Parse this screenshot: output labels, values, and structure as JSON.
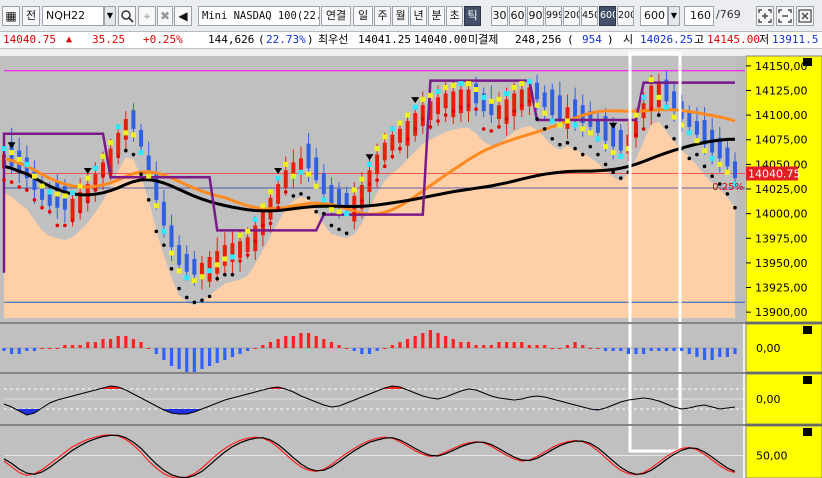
{
  "toolbar": {
    "dropdown_icon": "▼",
    "grid_icon_label": "▦",
    "mode_label": "전",
    "symbol": "NQH22",
    "search_icon": "search-icon",
    "close_label": "✖",
    "cursor_icon_label": "⌖",
    "volume_icon_label": "◀",
    "instrument_name": "Mini NASDAQ 100(22.03)",
    "linked_label": "연결",
    "period_labels": [
      "일",
      "주",
      "월",
      "년",
      "분",
      "초",
      "틱"
    ],
    "selected_period": "틱",
    "tick_presets": [
      "30",
      "60",
      "90",
      "999",
      "200",
      "450",
      "600",
      "200"
    ],
    "selected_tick": "600",
    "tick_value": "600",
    "view_count": "160",
    "total_count": "/769",
    "colors": {
      "selected_bg": "#44506a"
    }
  },
  "quote": {
    "price": "14040.75",
    "direction_icon": "▲",
    "change": "35.25",
    "change_pct": "+0.25%",
    "volume": "144,626",
    "volume_ratio": "22.73%",
    "best_ask_label": "최우선",
    "best_ask": "14041.25",
    "best_bid": "14040.00",
    "open_interest_label": "미결제",
    "open_interest": "248,256",
    "oi_change": "954",
    "open_label": "시",
    "open": "14026.25",
    "high_label": "고",
    "high": "14145.00",
    "low_label": "저",
    "low": "13911.5"
  },
  "chart_data": [
    {
      "type": "line",
      "panel": "price",
      "description": "Candlestick price chart with moving averages, parabolic SAR and channel",
      "y_ticks": [
        "14150,00",
        "14125,00",
        "14100,00",
        "14075,00",
        "14050,00",
        "14025,00",
        "14000,00",
        "13975,00",
        "13950,00",
        "13925,00",
        "13900,00"
      ],
      "ylim": [
        13890,
        14160
      ],
      "last_price_label": "14040.75",
      "last_change_label": "0.25%",
      "colors": {
        "up": "#e8200a",
        "down": "#3060e0",
        "cyan": "#30e8ff",
        "yellow": "#f0f020",
        "ma_orange": "#ff8a20",
        "ma_black": "#000000",
        "channel": "#7a1a8a",
        "fill": "#ffcfa8",
        "background": "#c0c0c0",
        "label_bg": "#ffff00"
      },
      "series": [
        {
          "values": [
            14056,
            14052,
            14045,
            14040,
            14028,
            14018,
            14012,
            14010,
            14008,
            14011,
            14018,
            14026,
            14036,
            14048,
            14062,
            14078,
            14092,
            14090,
            14072,
            14048,
            14018,
            13992,
            13970,
            13952,
            13945,
            13942,
            13946,
            13952,
            13958,
            13964,
            13966,
            13968,
            13972,
            13984,
            13998,
            14012,
            14026,
            14040,
            14048,
            14052,
            14050,
            14038,
            14024,
            14014,
            14012,
            14010,
            14014,
            14025,
            14040,
            14056,
            14068,
            14076,
            14082,
            14090,
            14098,
            14106,
            14110,
            14114,
            14118,
            14120,
            14122,
            14122,
            14116,
            14108,
            14104,
            14106,
            14112,
            14118,
            14122,
            14124,
            14120,
            14112,
            14104,
            14100,
            14104,
            14100,
            14096,
            14092,
            14086,
            14078,
            14072,
            14068,
            14076,
            14090,
            14108,
            14126,
            14128,
            14118,
            14108,
            14100,
            14092,
            14084,
            14074,
            14066,
            14060,
            14052,
            14040
          ]
        }
      ]
    },
    {
      "type": "bar",
      "panel": "histogram",
      "y_ticks": [
        "0,00"
      ],
      "values": [
        -1,
        -2,
        -2,
        -1,
        -1,
        0,
        0,
        0,
        1,
        1,
        1,
        2,
        2,
        3,
        3,
        4,
        4,
        3,
        2,
        0,
        -2,
        -4,
        -6,
        -7,
        -8,
        -8,
        -7,
        -6,
        -5,
        -4,
        -3,
        -2,
        -1,
        0,
        1,
        2,
        3,
        4,
        4,
        5,
        5,
        4,
        3,
        2,
        1,
        0,
        -1,
        -2,
        -2,
        -1,
        0,
        1,
        2,
        3,
        4,
        5,
        6,
        5,
        4,
        3,
        2,
        2,
        1,
        1,
        1,
        2,
        2,
        2,
        2,
        1,
        1,
        1,
        0,
        0,
        1,
        2,
        1,
        0,
        0,
        -1,
        -1,
        -1,
        -2,
        -2,
        -2,
        -1,
        -1,
        -1,
        -1,
        -1,
        -2,
        -3,
        -4,
        -4,
        -3,
        -3,
        -2
      ]
    },
    {
      "type": "area",
      "panel": "oscillator",
      "y_ticks": [
        "0,00"
      ],
      "values": [
        -5,
        -8,
        -12,
        -16,
        -14,
        -9,
        -4,
        -1,
        1,
        3,
        5,
        7,
        9,
        11,
        13,
        12,
        9,
        5,
        1,
        -3,
        -7,
        -11,
        -14,
        -15,
        -15,
        -13,
        -10,
        -7,
        -4,
        -1,
        1,
        3,
        5,
        7,
        9,
        11,
        12,
        10,
        7,
        3,
        0,
        -3,
        -6,
        -8,
        -7,
        -4,
        -1,
        2,
        5,
        8,
        11,
        13,
        12,
        9,
        6,
        3,
        1,
        0,
        2,
        5,
        8,
        10,
        9,
        6,
        3,
        1,
        0,
        -1,
        0,
        2,
        3,
        2,
        0,
        -2,
        -4,
        -6,
        -8,
        -10,
        -11,
        -9,
        -6,
        -3,
        -1,
        0,
        1,
        0,
        -2,
        -5,
        -8,
        -10,
        -9,
        -7,
        -6,
        -8,
        -10,
        -9,
        -8
      ]
    },
    {
      "type": "line",
      "panel": "stochastic",
      "y_ticks": [
        "50,00"
      ],
      "series": [
        {
          "values": [
            40,
            30,
            20,
            15,
            18,
            25,
            35,
            45,
            55,
            65,
            72,
            78,
            82,
            85,
            86,
            84,
            78,
            68,
            55,
            40,
            28,
            18,
            12,
            10,
            12,
            18,
            28,
            40,
            52,
            62,
            70,
            76,
            80,
            82,
            80,
            74,
            64,
            52,
            40,
            30,
            24,
            22,
            26,
            34,
            44,
            54,
            62,
            70,
            76,
            80,
            82,
            80,
            74,
            66,
            58,
            52,
            48,
            50,
            56,
            62,
            68,
            72,
            74,
            72,
            66,
            58,
            50,
            44,
            40,
            42,
            48,
            56,
            64,
            70,
            74,
            76,
            74,
            68,
            58,
            46,
            34,
            24,
            18,
            16,
            20,
            28,
            38,
            48,
            56,
            62,
            64,
            60,
            52,
            42,
            32,
            24,
            20
          ]
        },
        {
          "values": [
            44,
            36,
            26,
            19,
            17,
            21,
            29,
            39,
            49,
            59,
            67,
            74,
            79,
            83,
            85,
            85,
            81,
            73,
            62,
            48,
            35,
            24,
            16,
            12,
            11,
            15,
            22,
            33,
            45,
            56,
            65,
            72,
            77,
            80,
            81,
            77,
            69,
            58,
            46,
            35,
            27,
            23,
            24,
            30,
            39,
            49,
            58,
            66,
            73,
            77,
            80,
            81,
            77,
            70,
            62,
            55,
            50,
            49,
            53,
            59,
            65,
            70,
            73,
            73,
            69,
            62,
            54,
            47,
            42,
            41,
            45,
            52,
            60,
            67,
            72,
            75,
            75,
            71,
            63,
            52,
            40,
            29,
            21,
            17,
            18,
            24,
            33,
            43,
            52,
            59,
            63,
            62,
            56,
            47,
            37,
            28,
            22
          ]
        }
      ]
    }
  ]
}
